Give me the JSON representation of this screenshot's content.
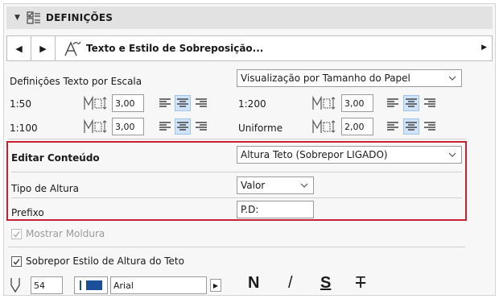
{
  "section": {
    "title": "DEFINIÇÕES",
    "icon": "settings-list-icon",
    "collapse_icon": "triangle-down-icon"
  },
  "nav": {
    "prev_icon": "triangle-left-icon",
    "next_icon": "triangle-right-icon",
    "icon": "text-style-icon",
    "title": "Texto e Estilo de Sobreposição...",
    "expand_icon": "triangle-right-small-icon"
  },
  "scale": {
    "label": "Definições Texto por Escala",
    "mode": "Visualização por Tamanho do Papel",
    "rows": [
      {
        "left_scale": "1:50",
        "left_value": "3,00",
        "left_selected": "center",
        "right_scale": "1:200",
        "right_value": "3,00",
        "right_selected": "center"
      },
      {
        "left_scale": "1:100",
        "left_value": "3,00",
        "left_selected": "center",
        "right_scale": "Uniforme",
        "right_value": "2,00",
        "right_selected": "center"
      }
    ]
  },
  "edit": {
    "label": "Editar Conteúdo",
    "value": "Altura Teto (Sobrepor LIGADO)"
  },
  "height_type": {
    "label": "Tipo de Altura",
    "value": "Valor"
  },
  "prefix": {
    "label": "Prefixo",
    "value": "P.D:"
  },
  "show_frame": {
    "label": "Mostrar Moldura",
    "checked": true,
    "disabled": true
  },
  "override": {
    "label": "Sobrepor Estilo de Altura do Teto",
    "checked": true
  },
  "font_bar": {
    "pen_value": "54",
    "font_name": "Arial",
    "bold": "N",
    "italic": "/",
    "underline": "S",
    "strike": "T",
    "color": "#1a4f9c"
  }
}
